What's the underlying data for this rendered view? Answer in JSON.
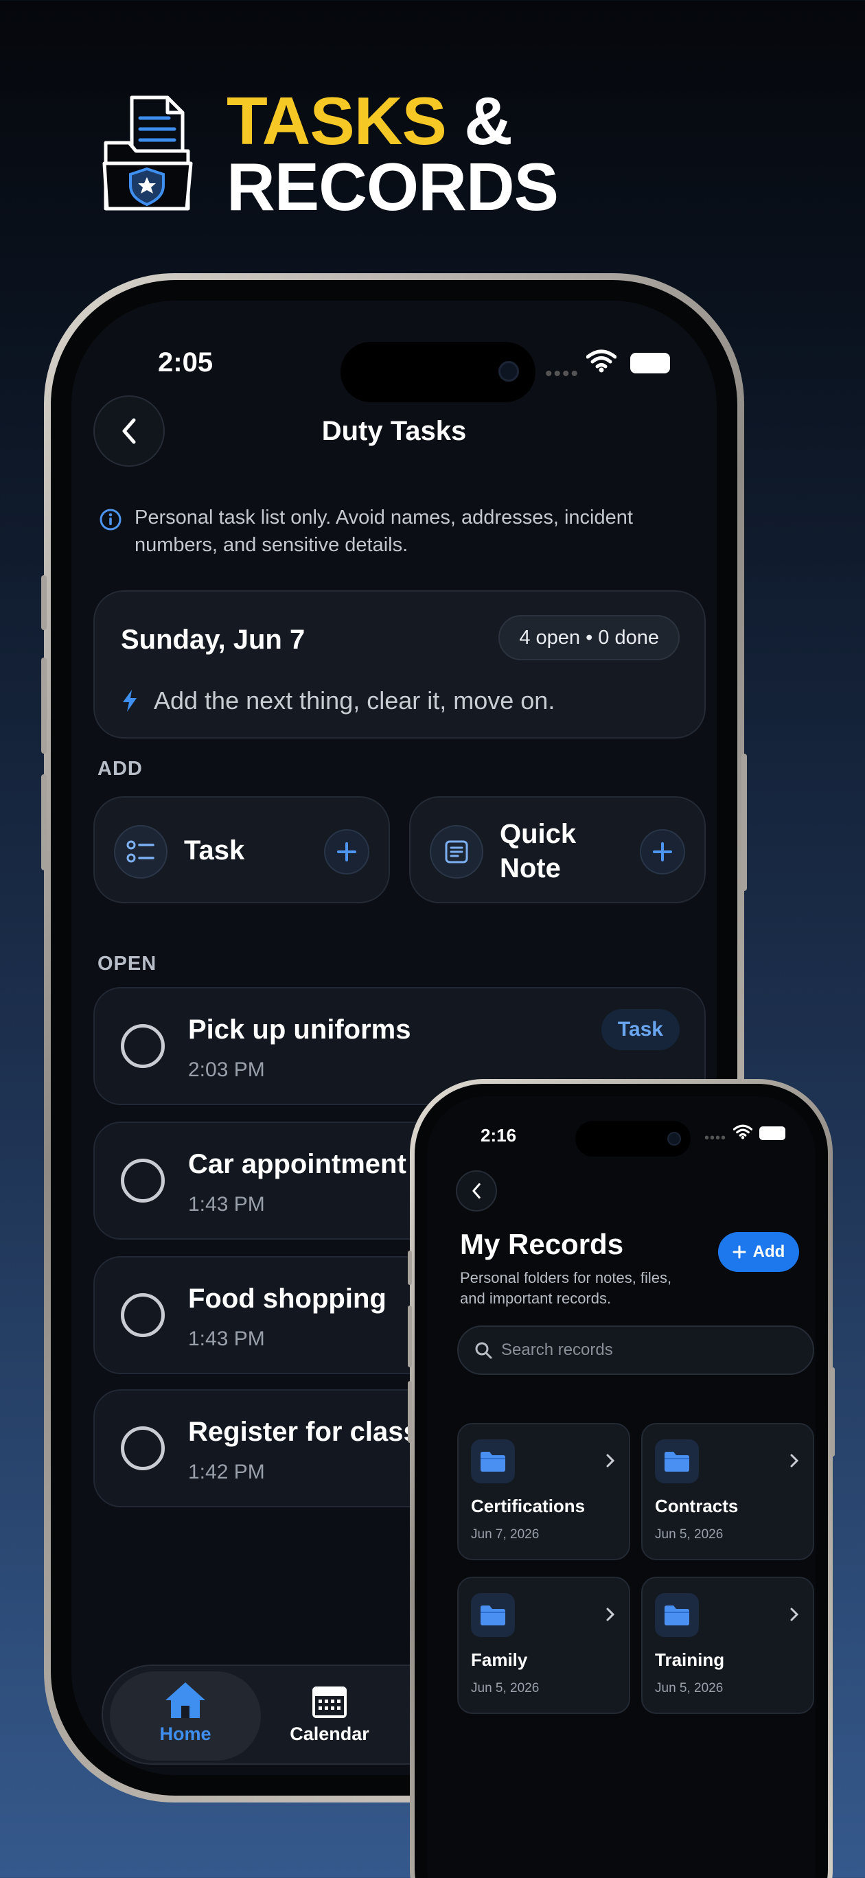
{
  "hero": {
    "word1": "TASKS",
    "word2": "&",
    "word3": "RECORDS"
  },
  "phone1": {
    "status_time": "2:05",
    "nav_title": "Duty Tasks",
    "notice": "Personal task list only. Avoid names, addresses, incident numbers, and sensitive details.",
    "date_card": {
      "date": "Sunday, Jun 7",
      "summary": "4 open • 0 done",
      "tip": "Add the next thing, clear it, move on."
    },
    "add_section": "ADD",
    "add_task_label": "Task",
    "add_note_label_1": "Quick",
    "add_note_label_2": "Note",
    "open_section": "OPEN",
    "tasks": [
      {
        "title": "Pick up uniforms",
        "time": "2:03 PM",
        "tag": "Task"
      },
      {
        "title": "Car appointment",
        "time": "1:43 PM"
      },
      {
        "title": "Food shopping",
        "time": "1:43 PM"
      },
      {
        "title": "Register for class",
        "time": "1:42 PM"
      }
    ],
    "tabs": {
      "home": "Home",
      "calendar": "Calendar"
    },
    "colors": {
      "accent": "#3f8ff0",
      "tag_bg": "#16253a"
    }
  },
  "phone2": {
    "status_time": "2:16",
    "title": "My Records",
    "subtitle": "Personal folders for notes, files, and important records.",
    "add_label": "Add",
    "search_placeholder": "Search records",
    "folders": [
      {
        "name": "Certifications",
        "date": "Jun 7, 2026"
      },
      {
        "name": "Contracts",
        "date": "Jun 5, 2026"
      },
      {
        "name": "Family",
        "date": "Jun 5, 2026"
      },
      {
        "name": "Training",
        "date": "Jun 5, 2026"
      }
    ],
    "colors": {
      "add_button": "#1d78ee",
      "folder_icon": "#4a8ff2"
    }
  }
}
